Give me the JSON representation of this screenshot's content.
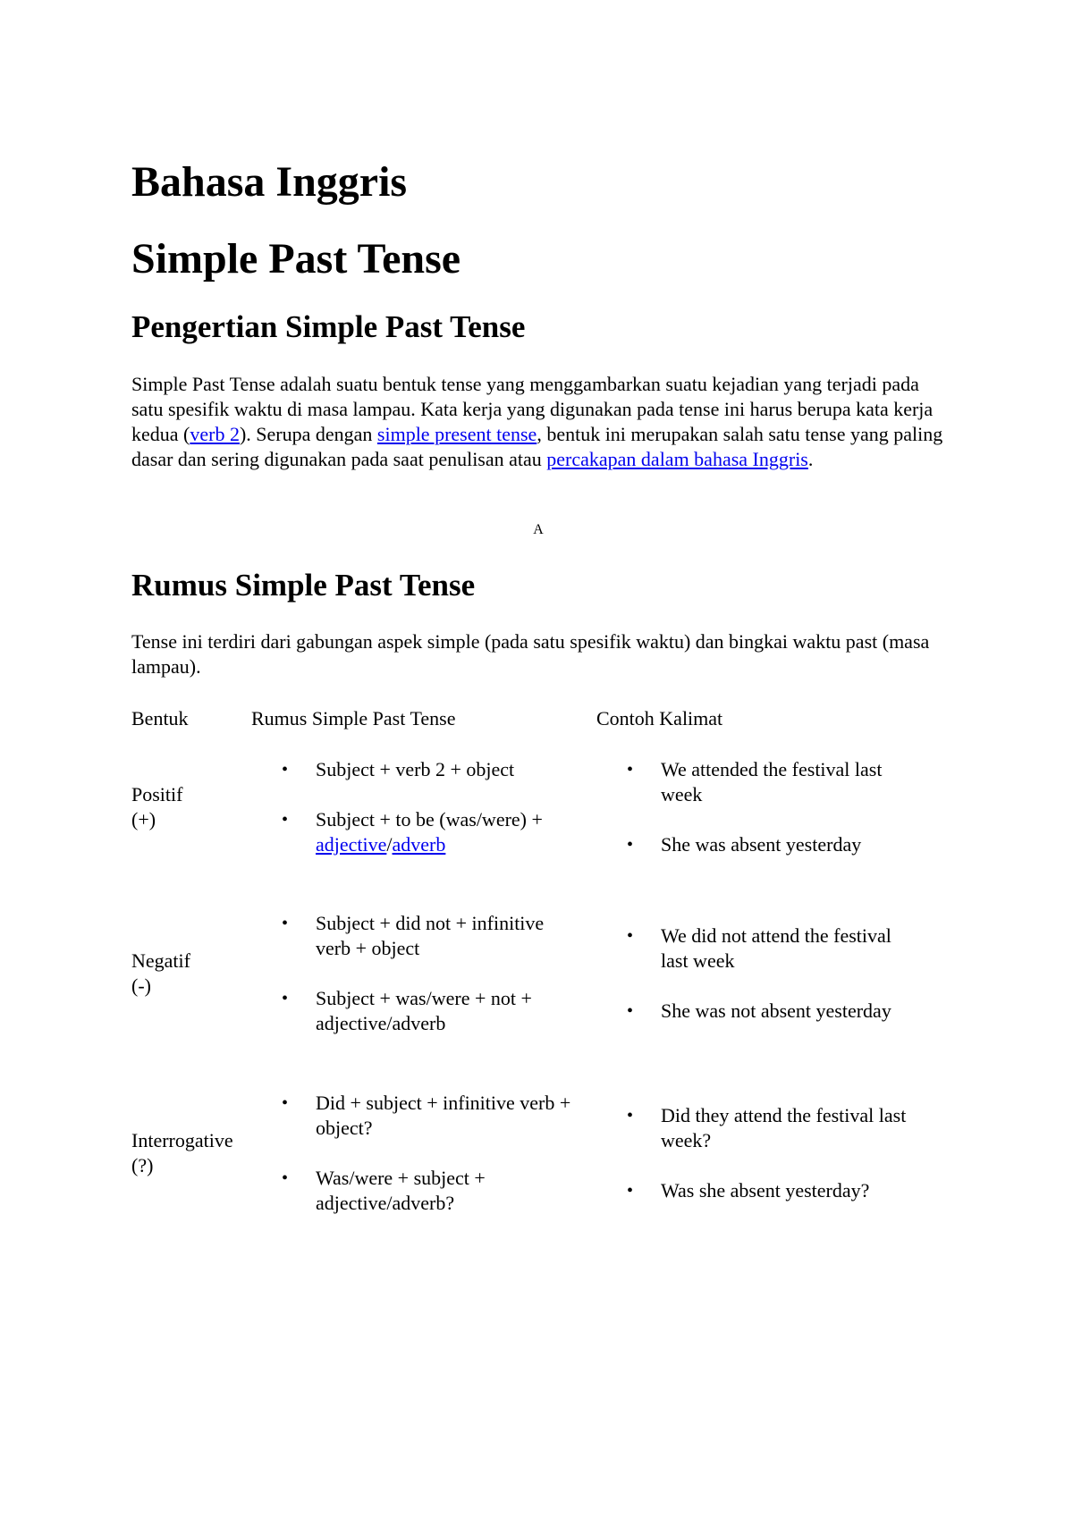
{
  "document": {
    "title": "Bahasa Inggris",
    "subtitle": "Simple Past Tense",
    "section1": {
      "heading": "Pengertian Simple Past Tense",
      "paragraph": {
        "text1": "Simple Past Tense adalah suatu bentuk tense yang menggambarkan suatu kejadian yang terjadi pada satu spesifik waktu di masa lampau. Kata kerja yang digunakan pada tense ini harus berupa kata kerja kedua (",
        "link1": "verb 2",
        "text2": "). Serupa dengan ",
        "link2": "simple present tense",
        "text3": ", bentuk ini merupakan salah satu tense yang paling dasar dan sering digunakan pada saat penulisan atau ",
        "link3": "percakapan dalam bahasa Inggris",
        "text4": "."
      }
    },
    "center_mark": "A",
    "section2": {
      "heading": "Rumus Simple Past Tense",
      "paragraph": "Tense ini terdiri dari gabungan aspek simple (pada satu spesifik waktu) dan bingkai waktu past (masa lampau).",
      "table": {
        "headers": [
          "Bentuk",
          "Rumus Simple Past Tense",
          "Contoh Kalimat"
        ],
        "bullet": "•",
        "rows": [
          {
            "form": "Positif",
            "symbol": "(+)",
            "formulas": [
              {
                "text": "Subject + verb 2 + object"
              },
              {
                "text": "Subject + to be (was/were) + ",
                "link_a": "adjective",
                "sep": "/",
                "link_b": "adverb"
              }
            ],
            "examples": [
              "We attended the festival last week",
              "She was absent yesterday"
            ]
          },
          {
            "form": "Negatif",
            "symbol": "(-)",
            "formulas": [
              {
                "text": "Subject + did not + infinitive verb + object"
              },
              {
                "text": "Subject + was/were + not + adjective/adverb"
              }
            ],
            "examples": [
              "We did not attend the festival last week",
              "She was not absent yesterday"
            ]
          },
          {
            "form": "Interrogative",
            "symbol": "(?)",
            "formulas": [
              {
                "text": "Did + subject + infinitive verb + object?"
              },
              {
                "text": "Was/were + subject + adjective/adverb?"
              }
            ],
            "examples": [
              "Did they attend the festival last week?",
              "Was she absent yesterday?"
            ]
          }
        ]
      }
    }
  },
  "colors": {
    "link": "#0000ee",
    "text": "#000000",
    "background": "#ffffff"
  }
}
